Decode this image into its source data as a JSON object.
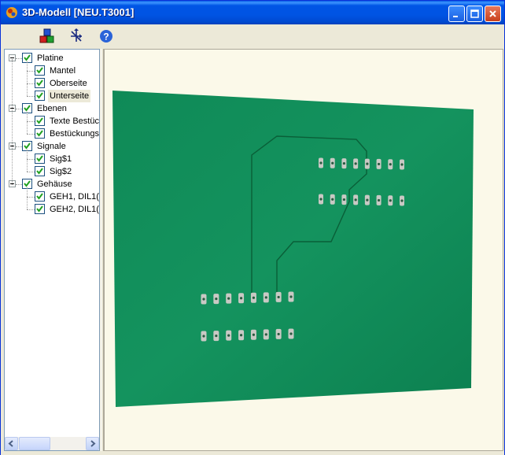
{
  "window": {
    "title": "3D-Modell  [NEU.T3001]",
    "controls": [
      "minimize",
      "maximize",
      "close"
    ]
  },
  "toolbar": {
    "buttons": [
      {
        "name": "colors-icon"
      },
      {
        "name": "view-settings-icon"
      },
      {
        "name": "help-icon"
      }
    ]
  },
  "tree": {
    "groups": [
      {
        "label": "Platine",
        "checked": true,
        "children": [
          {
            "label": "Mantel",
            "checked": true
          },
          {
            "label": "Oberseite",
            "checked": true
          },
          {
            "label": "Unterseite",
            "checked": true,
            "selected": true
          }
        ]
      },
      {
        "label": "Ebenen",
        "checked": true,
        "children": [
          {
            "label": "Texte Bestüc",
            "checked": true
          },
          {
            "label": "Bestückungs",
            "checked": true
          }
        ]
      },
      {
        "label": "Signale",
        "checked": true,
        "children": [
          {
            "label": "Sig$1",
            "checked": true
          },
          {
            "label": "Sig$2",
            "checked": true
          }
        ]
      },
      {
        "label": "Gehäuse",
        "checked": true,
        "children": [
          {
            "label": "GEH1, DIL1(",
            "checked": true
          },
          {
            "label": "GEH2, DIL1(",
            "checked": true
          }
        ]
      }
    ]
  },
  "board": {
    "color": "#0f8a57",
    "pad_color": "#c9c9c4"
  }
}
